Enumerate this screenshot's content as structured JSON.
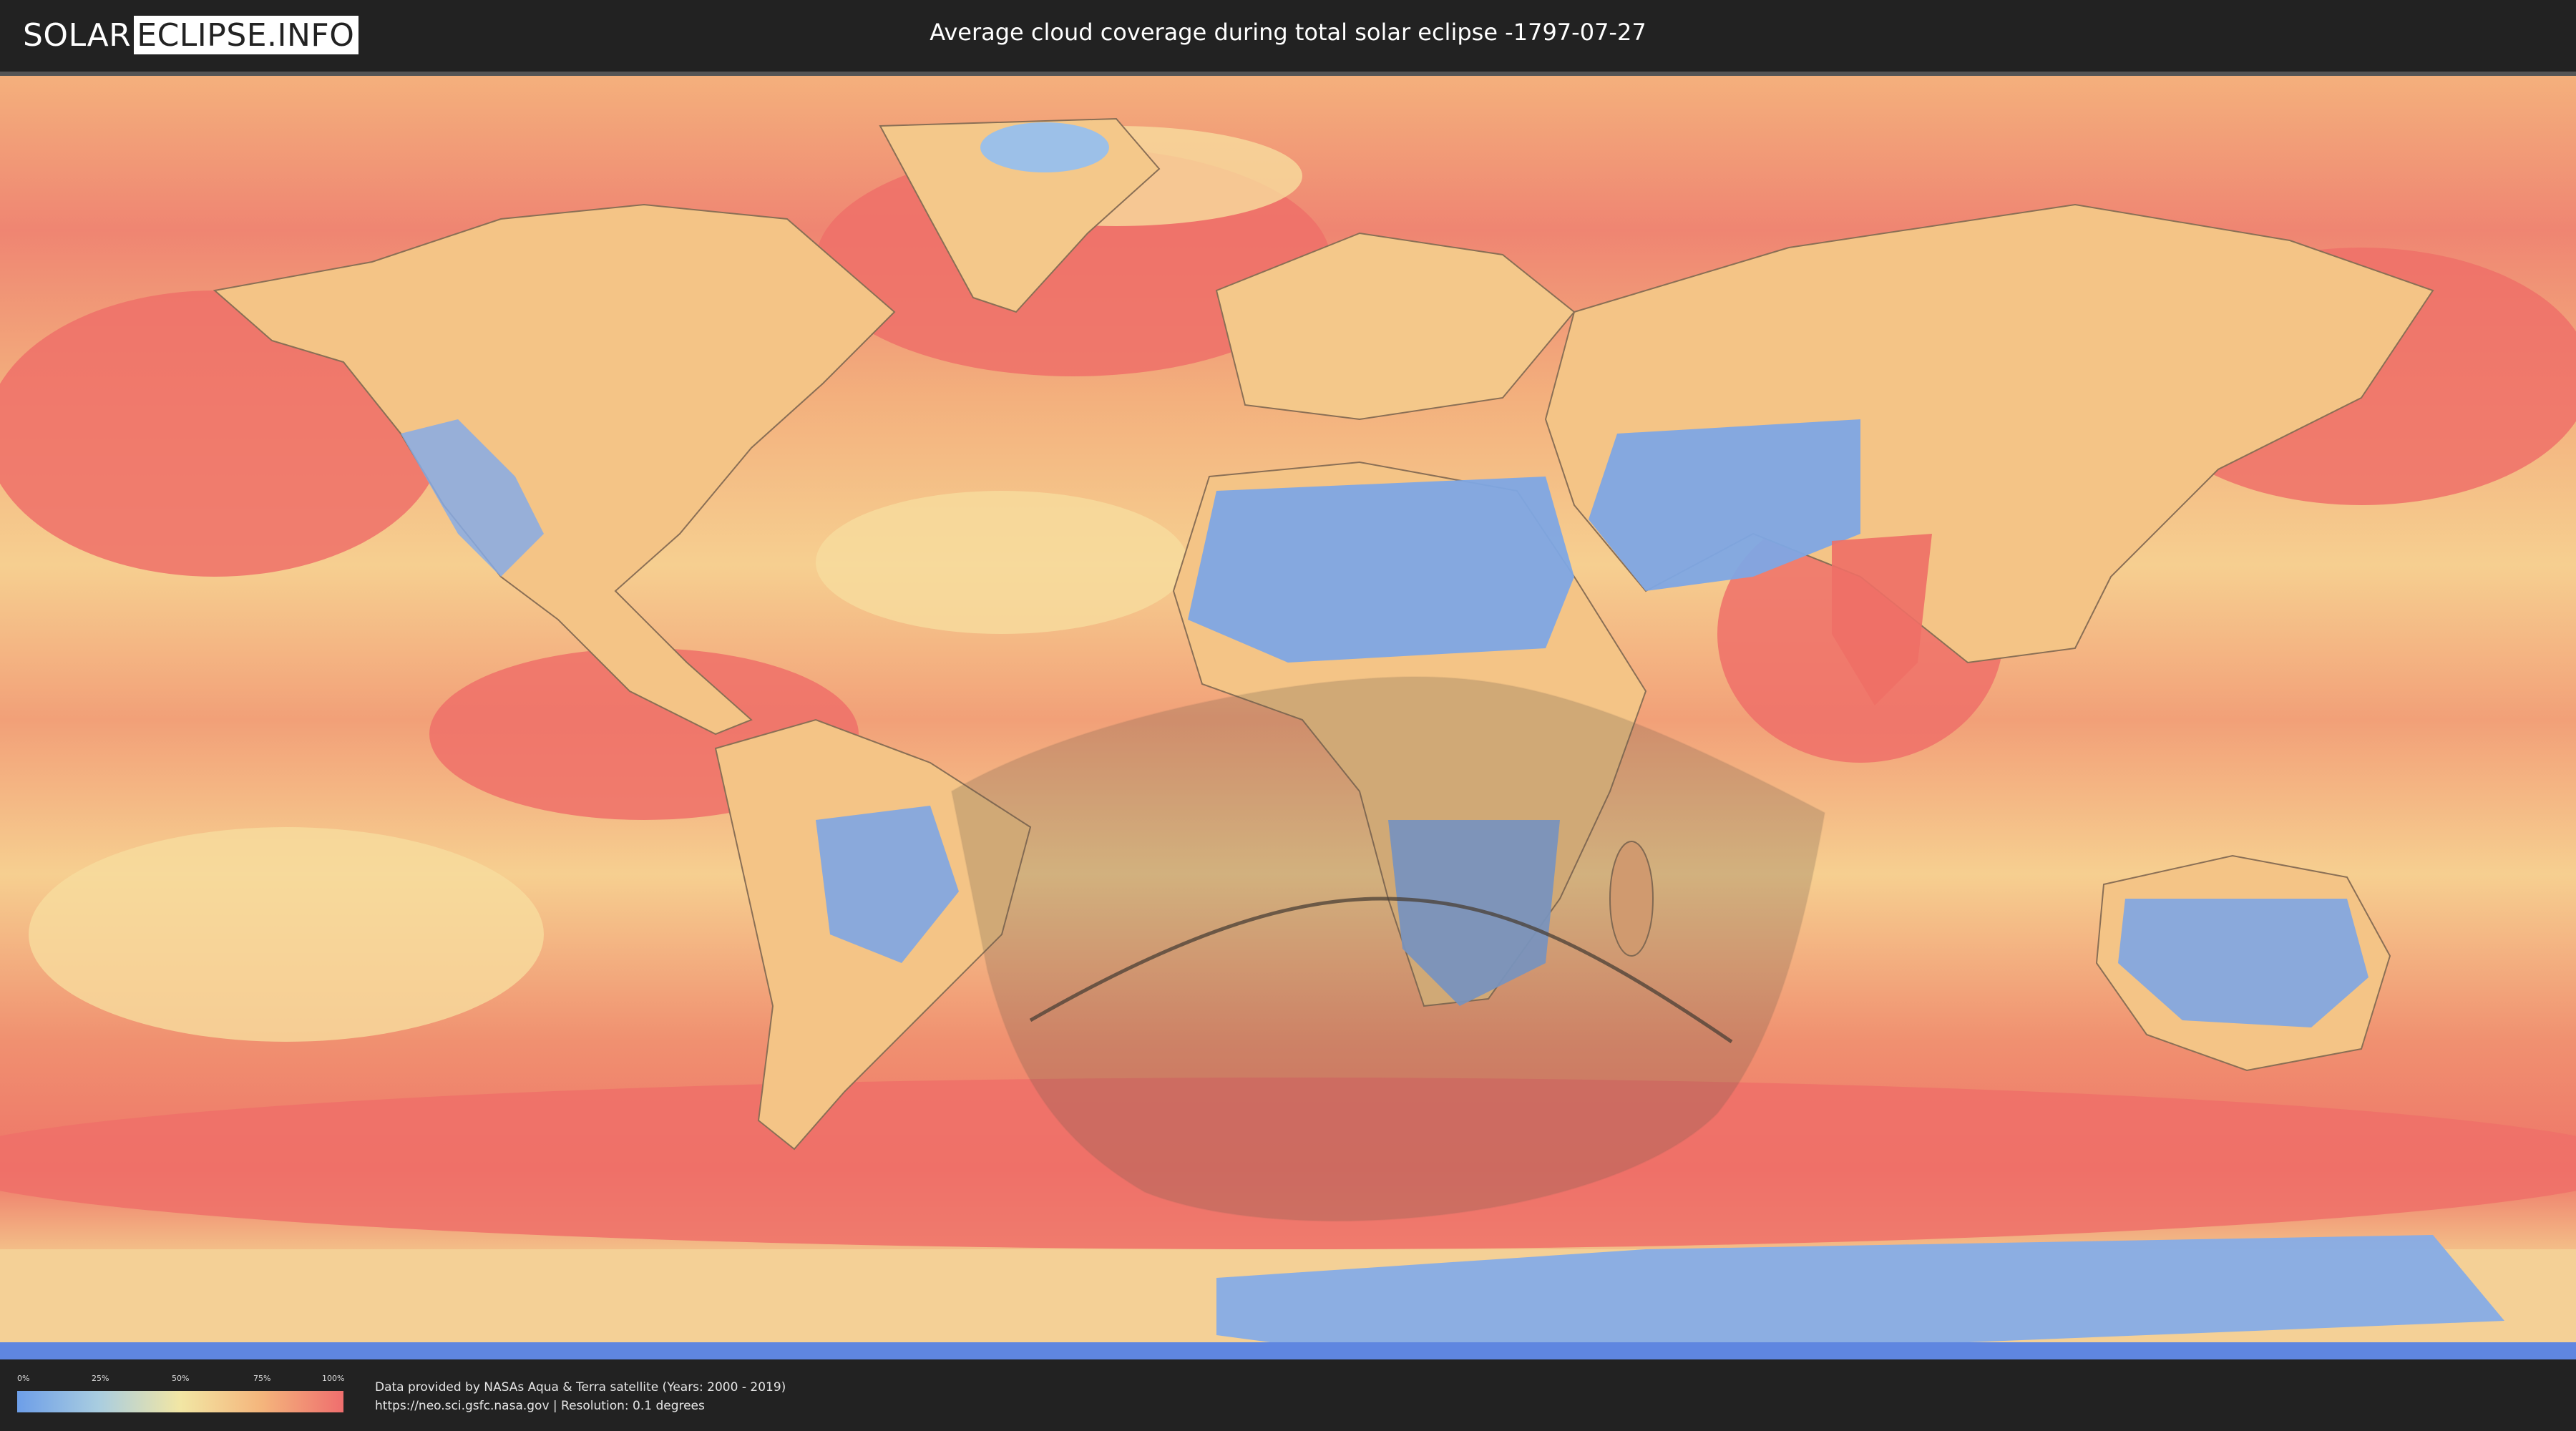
{
  "header": {
    "logo_left": "SOLAR",
    "logo_right": "ECLIPSE.INFO",
    "title": "Average cloud coverage during total solar eclipse -1797-07-27"
  },
  "legend": {
    "ticks": [
      "0%",
      "25%",
      "50%",
      "75%",
      "100%"
    ],
    "colors": [
      "#6d9ee8",
      "#a9cde0",
      "#f2e6a4",
      "#f4b57c",
      "#ef6e6e"
    ]
  },
  "credits": {
    "line1": "Data provided by NASAs Aqua & Terra satellite (Years: 2000 - 2019)",
    "line2": "https://neo.sci.gsfc.nasa.gov | Resolution: 0.1 degrees"
  },
  "map": {
    "colors": {
      "ocean_high": "#ee7870",
      "ocean_mid": "#f4b27c",
      "ocean_low": "#f6d796",
      "clear": "#7ea6e4",
      "deep_clear": "#5f86e0",
      "eclipse_shade": "#6a5a4a"
    }
  }
}
